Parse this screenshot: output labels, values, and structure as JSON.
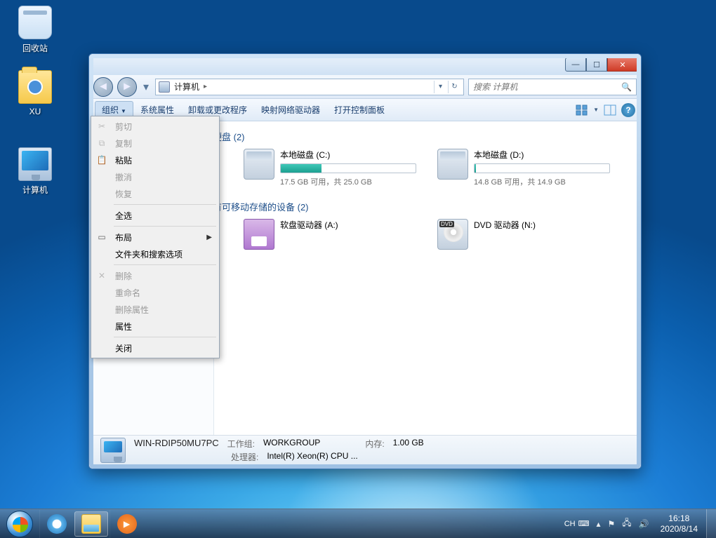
{
  "desktop_icons": {
    "recycle": "回收站",
    "folder_xu": "XU",
    "computer": "计算机"
  },
  "window": {
    "titlebar": {
      "min": "—",
      "max": "☐",
      "close": "✕"
    },
    "nav": {
      "back": "◄",
      "fwd": "►",
      "drop": "▾"
    },
    "address": {
      "location": "计算机",
      "sep": "▸",
      "drop": "▾",
      "refresh": "↻"
    },
    "search": {
      "placeholder": "搜索 计算机"
    },
    "toolbar": {
      "organize": "组织",
      "props": "系统属性",
      "uninstall": "卸载或更改程序",
      "mapdrive": "映射网络驱动器",
      "ctrlpanel": "打开控制面板"
    },
    "content": {
      "group_hdd": "硬盘 (2)",
      "group_removable": "有可移动存储的设备 (2)",
      "drive_c": {
        "name": "本地磁盘 (C:)",
        "free": "17.5 GB 可用，共 25.0 GB",
        "pct": 30
      },
      "drive_d": {
        "name": "本地磁盘 (D:)",
        "free": "14.8 GB 可用，共 14.9 GB",
        "pct": 1
      },
      "drive_a": {
        "name": "软盘驱动器 (A:)"
      },
      "drive_n": {
        "name": "DVD 驱动器 (N:)"
      }
    },
    "details": {
      "name": "WIN-RDIP50MU7PC",
      "workgroup_lbl": "工作组:",
      "workgroup": "WORKGROUP",
      "cpu_lbl": "处理器:",
      "cpu": "Intel(R) Xeon(R) CPU ...",
      "mem_lbl": "内存:",
      "mem": "1.00 GB"
    }
  },
  "menu": {
    "cut": "剪切",
    "copy": "复制",
    "paste": "粘贴",
    "undo": "撤消",
    "redo": "恢复",
    "selectall": "全选",
    "layout": "布局",
    "folderopts": "文件夹和搜索选项",
    "delete": "删除",
    "rename": "重命名",
    "removeprops": "删除属性",
    "properties": "属性",
    "close": "关闭"
  },
  "taskbar": {
    "lang": "CH",
    "time": "16:18",
    "date": "2020/8/14"
  }
}
